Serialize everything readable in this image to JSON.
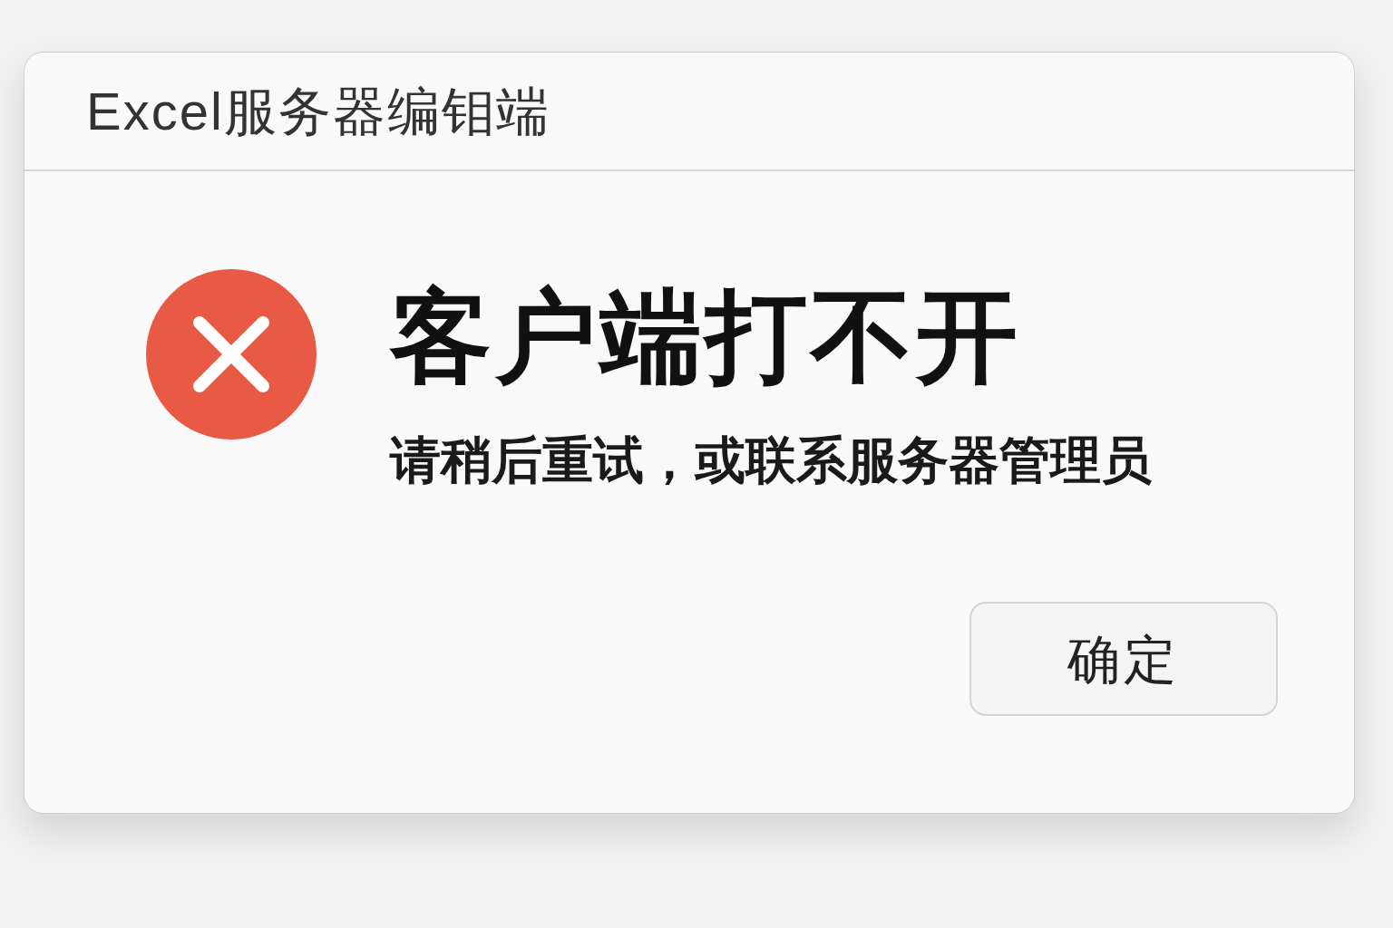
{
  "window": {
    "title": "Excel服务器编钼端"
  },
  "message": {
    "kind": "error",
    "heading": "客户端打不开",
    "detail": "请稍后重试，或联系服务器管理员"
  },
  "buttons": [
    "确定"
  ]
}
